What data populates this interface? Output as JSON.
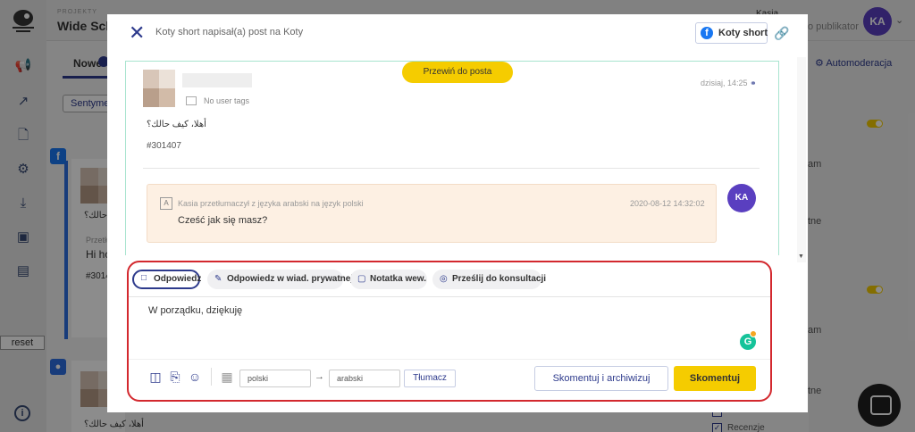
{
  "app": {
    "project_small": "PROJEKTY",
    "project_name": "Wide Sche",
    "user_name": "Kasia",
    "user_role": "o publikator",
    "user_initials": "KA",
    "reset_label": "reset",
    "tab_new": "Nowe",
    "sentiment_btn": "Sentymen",
    "automod_label": "Automoderacja",
    "right_fragments": [
      "am",
      "tne",
      "am",
      "tne",
      "Recenzje"
    ],
    "feed_items": [
      {
        "text1": "أهلا، كيف حالك؟",
        "text2": "Przetłu",
        "text3": "Hi ho",
        "text4": "#3014"
      },
      {
        "text1": "أهلا، كيف حالك؟"
      }
    ]
  },
  "modal": {
    "header": {
      "author": "Koty short",
      "action": " napisał(a) post na ",
      "target": "Koty",
      "page_button_label": "Koty short"
    },
    "post": {
      "jump_button": "Przewiń do posta",
      "no_user_tags": "No user tags",
      "time": "dzisiaj, 14:25",
      "text": "أهلا، كيف حالك؟",
      "id": "#301407"
    },
    "translation": {
      "meta": "Kasia przetłumaczył z języka arabski na język polski",
      "date": "2020-08-12 14:32:02",
      "text": "Cześć jak się masz?",
      "avatar": "KA"
    },
    "reply": {
      "tabs": [
        {
          "label": "Odpowiedz",
          "icon": "chat-bubble-icon",
          "active": true
        },
        {
          "label": "Odpowiedz w wiad. prywatnej",
          "icon": "private-message-icon",
          "active": false
        },
        {
          "label": "Notatka wew.",
          "icon": "note-icon",
          "active": false
        },
        {
          "label": "Prześlij do konsultacji",
          "icon": "consult-icon",
          "active": false
        }
      ],
      "text": "W porządku, dziękuję",
      "source_lang": "polski",
      "target_lang": "arabski",
      "translate_btn": "Tłumacz",
      "archive_btn": "Skomentuj i archiwizuj",
      "comment_btn": "Skomentuj"
    }
  },
  "colors": {
    "accent": "#2d3a8c",
    "yellow": "#f5cc00",
    "highlight_border": "#d3282e",
    "avatar": "#5a3fc0",
    "facebook": "#1877f2"
  }
}
